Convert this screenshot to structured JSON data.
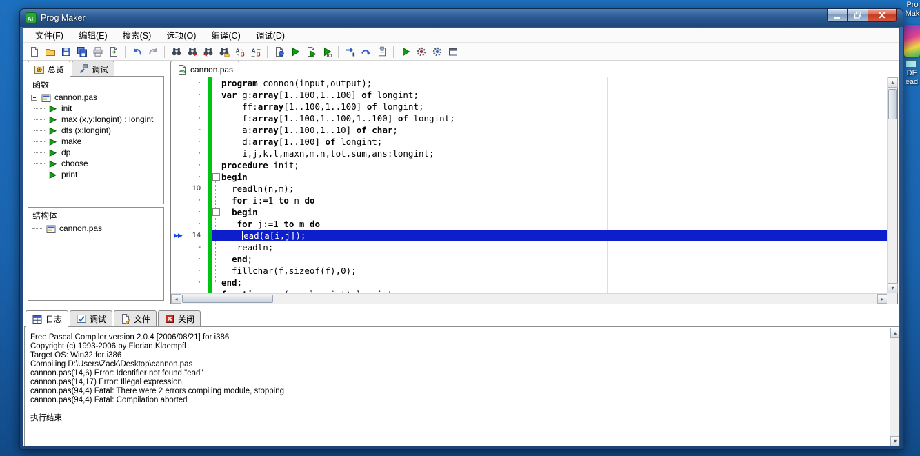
{
  "colors": {
    "selection_blue": "#0d1ecb",
    "change_bar_green": "#00c414",
    "close_button_red": "#c23c22",
    "titlebar_blue": "#2b5a94"
  },
  "desktop": {
    "icons": [
      {
        "label_lines": [
          "Pro",
          "Mak"
        ]
      },
      {
        "label_lines": [
          "DF",
          "ead"
        ]
      }
    ]
  },
  "window": {
    "title": "Prog Maker",
    "icon_text": "AI"
  },
  "menubar": {
    "items": [
      {
        "id": "file",
        "label": "文件(F)"
      },
      {
        "id": "edit",
        "label": "编辑(E)"
      },
      {
        "id": "search",
        "label": "搜索(S)"
      },
      {
        "id": "options",
        "label": "选项(O)"
      },
      {
        "id": "compile",
        "label": "编译(C)"
      },
      {
        "id": "debug",
        "label": "调试(D)"
      }
    ]
  },
  "toolbar": {
    "groups": [
      {
        "icons": [
          {
            "name": "new-file",
            "type": "page"
          },
          {
            "name": "open-file",
            "type": "folder"
          },
          {
            "name": "save-file",
            "type": "floppy"
          },
          {
            "name": "save-all",
            "type": "floppy2"
          },
          {
            "name": "print",
            "type": "printer"
          },
          {
            "name": "export",
            "type": "pagearrow"
          }
        ]
      },
      {
        "icons": [
          {
            "name": "undo",
            "type": "undo"
          },
          {
            "name": "redo",
            "type": "redo"
          }
        ]
      },
      {
        "icons": [
          {
            "name": "find",
            "type": "binoc"
          },
          {
            "name": "find-next",
            "type": "binocnext"
          },
          {
            "name": "find-previous",
            "type": "binocprev"
          },
          {
            "name": "find-in-files",
            "type": "binocfolder"
          },
          {
            "name": "replace",
            "type": "replace"
          },
          {
            "name": "replace-all",
            "type": "replaceall"
          }
        ]
      },
      {
        "icons": [
          {
            "name": "compile",
            "type": "compile"
          },
          {
            "name": "run",
            "type": "run"
          },
          {
            "name": "compile-and-run",
            "type": "runpage"
          },
          {
            "name": "build-all",
            "type": "run101"
          }
        ]
      },
      {
        "icons": [
          {
            "name": "step-into",
            "type": "stepinto"
          },
          {
            "name": "step-over",
            "type": "stepover"
          },
          {
            "name": "add-watch",
            "type": "watch"
          }
        ]
      },
      {
        "icons": [
          {
            "name": "debug-run",
            "type": "run"
          },
          {
            "name": "profile",
            "type": "gearred"
          },
          {
            "name": "stop",
            "type": "gear"
          },
          {
            "name": "view-windows",
            "type": "winicon"
          }
        ]
      }
    ]
  },
  "sidebar": {
    "tabs": [
      {
        "id": "overview",
        "label": "总览",
        "icon": "overview",
        "active": true
      },
      {
        "id": "debug",
        "label": "调试",
        "icon": "hammer",
        "active": false
      }
    ],
    "functions": {
      "title": "函数",
      "root": "cannon.pas",
      "items": [
        {
          "label": "init"
        },
        {
          "label": "max (x,y:longint) : longint"
        },
        {
          "label": "dfs (x:longint)"
        },
        {
          "label": "make"
        },
        {
          "label": "dp"
        },
        {
          "label": "choose"
        },
        {
          "label": "print"
        }
      ]
    },
    "structs": {
      "title": "结构体",
      "root": "cannon.pas"
    }
  },
  "editor": {
    "tab": {
      "label": "cannon.pas",
      "icon_text": "PAS"
    },
    "lines": [
      {
        "g": "·",
        "seg": [
          [
            "program",
            "k"
          ],
          [
            " connon(input,output);",
            "p"
          ]
        ]
      },
      {
        "g": "·",
        "seg": [
          [
            "var",
            "k"
          ],
          [
            " g:",
            "p"
          ],
          [
            "array",
            "k"
          ],
          [
            "[1..100,1..100] ",
            "p"
          ],
          [
            "of",
            "k"
          ],
          [
            " longint;",
            "p"
          ]
        ]
      },
      {
        "g": "·",
        "seg": [
          [
            "    ff:",
            "p"
          ],
          [
            "array",
            "k"
          ],
          [
            "[1..100,1..100] ",
            "p"
          ],
          [
            "of",
            "k"
          ],
          [
            " longint;",
            "p"
          ]
        ]
      },
      {
        "g": "·",
        "seg": [
          [
            "    f:",
            "p"
          ],
          [
            "array",
            "k"
          ],
          [
            "[1..100,1..100,1..100] ",
            "p"
          ],
          [
            "of",
            "k"
          ],
          [
            " longint;",
            "p"
          ]
        ]
      },
      {
        "g": "-",
        "seg": [
          [
            "    a:",
            "p"
          ],
          [
            "array",
            "k"
          ],
          [
            "[1..100,1..10] ",
            "p"
          ],
          [
            "of",
            "k"
          ],
          [
            " ",
            "p"
          ],
          [
            "char",
            "k"
          ],
          [
            ";",
            "p"
          ]
        ]
      },
      {
        "g": "·",
        "seg": [
          [
            "    d:",
            "p"
          ],
          [
            "array",
            "k"
          ],
          [
            "[1..100] ",
            "p"
          ],
          [
            "of",
            "k"
          ],
          [
            " longint;",
            "p"
          ]
        ]
      },
      {
        "g": "·",
        "seg": [
          [
            "    i,j,k,l,maxn,m,n,tot,sum,ans:longint;",
            "p"
          ]
        ]
      },
      {
        "g": "·",
        "seg": [
          [
            "procedure",
            "k"
          ],
          [
            " init;",
            "p"
          ]
        ]
      },
      {
        "g": "·",
        "fold": true,
        "seg": [
          [
            "begin",
            "k"
          ]
        ]
      },
      {
        "g": "10",
        "seg": [
          [
            "  readln(n,m);",
            "p"
          ]
        ]
      },
      {
        "g": "·",
        "seg": [
          [
            "  ",
            "p"
          ],
          [
            "for",
            "k"
          ],
          [
            " i:=1 ",
            "p"
          ],
          [
            "to",
            "k"
          ],
          [
            " n ",
            "p"
          ],
          [
            "do",
            "k"
          ]
        ]
      },
      {
        "g": "·",
        "fold": true,
        "seg": [
          [
            "  ",
            "p"
          ],
          [
            "begin",
            "k"
          ]
        ]
      },
      {
        "g": "·",
        "seg": [
          [
            "   ",
            "p"
          ],
          [
            "for",
            "k"
          ],
          [
            " j:=1 ",
            "p"
          ],
          [
            "to",
            "k"
          ],
          [
            " m ",
            "p"
          ],
          [
            "do",
            "k"
          ]
        ]
      },
      {
        "g": "14",
        "hl": true,
        "marker": true,
        "seg": [
          [
            "    ",
            "p"
          ],
          [
            "",
            "c"
          ],
          [
            "ead(a[i,j]);",
            "p"
          ]
        ]
      },
      {
        "g": "-",
        "seg": [
          [
            "   readln;",
            "p"
          ]
        ]
      },
      {
        "g": "·",
        "seg": [
          [
            "  ",
            "p"
          ],
          [
            "end",
            "k"
          ],
          [
            ";",
            "p"
          ]
        ]
      },
      {
        "g": "·",
        "seg": [
          [
            "  fillchar(f,sizeof(f),0);",
            "p"
          ]
        ]
      },
      {
        "g": "·",
        "seg": [
          [
            "end",
            "k"
          ],
          [
            ";",
            "p"
          ]
        ]
      },
      {
        "g": "·",
        "seg": [
          [
            "function",
            "k"
          ],
          [
            " max(x,y:longint):longint;",
            "p"
          ]
        ]
      }
    ]
  },
  "bottom": {
    "tabs": [
      {
        "id": "log",
        "label": "日志",
        "icon": "log",
        "active": true
      },
      {
        "id": "debug",
        "label": "调试",
        "icon": "check",
        "active": false
      },
      {
        "id": "files",
        "label": "文件",
        "icon": "filetab",
        "active": false
      },
      {
        "id": "close",
        "label": "关闭",
        "icon": "closetab",
        "active": false
      }
    ],
    "log_lines": [
      "Free Pascal Compiler version 2.0.4 [2006/08/21] for i386",
      "Copyright (c) 1993-2006 by Florian Klaempfl",
      "Target OS: Win32 for i386",
      "Compiling D:\\Users\\Zack\\Desktop\\cannon.pas",
      "cannon.pas(14,6) Error: Identifier not found \"ead\"",
      "cannon.pas(14,17) Error: Illegal expression",
      "cannon.pas(94,4) Fatal: There were 2 errors compiling module, stopping",
      "cannon.pas(94,4) Fatal: Compilation aborted",
      "",
      "执行结束"
    ]
  }
}
